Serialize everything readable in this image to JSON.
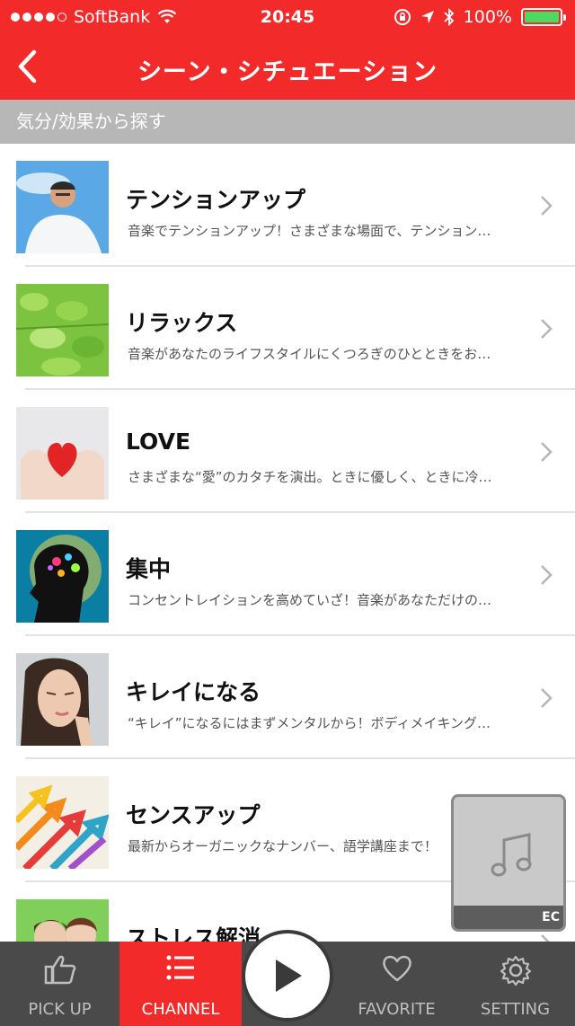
{
  "status": {
    "carrier": "SoftBank",
    "time": "20:45",
    "battery": "100%",
    "signal_bars": 5,
    "signal_filled": 4
  },
  "nav": {
    "title": "シーン・シチュエーション",
    "back_icon": "chevron-left-icon"
  },
  "section": {
    "header": "気分/効果から探す"
  },
  "items": [
    {
      "title": "テンションアップ",
      "desc": "音楽でテンションアップ！さまざまな場面で、テンション…",
      "thumb": "man-sky"
    },
    {
      "title": "リラックス",
      "desc": "音楽があなたのライフスタイルにくつろぎのひとときをお…",
      "thumb": "green-leaves"
    },
    {
      "title": "LOVE",
      "desc": "さまざまな“愛”のカタチを演出。ときに優しく、ときに冷…",
      "thumb": "heart-hands"
    },
    {
      "title": "集中",
      "desc": "コンセントレイションを高めていざ！音楽があなただけの…",
      "thumb": "brain"
    },
    {
      "title": "キレイになる",
      "desc": "“キレイ”になるにはまずメンタルから！ボディメイキング…",
      "thumb": "woman-face"
    },
    {
      "title": "センスアップ",
      "desc": "最新からオーガニックなナンバー、語学講座まで！",
      "thumb": "arrows"
    },
    {
      "title": "ストレス解消",
      "desc": "",
      "thumb": "people"
    }
  ],
  "mini_player": {
    "label": "EC"
  },
  "tabs": [
    {
      "label": "PICK UP",
      "icon": "thumbs-up-icon"
    },
    {
      "label": "CHANNEL",
      "icon": "list-icon"
    },
    {
      "label": "FAVORITE",
      "icon": "heart-icon"
    },
    {
      "label": "SETTING",
      "icon": "gear-icon"
    }
  ],
  "colors": {
    "brand_red": "#f22a2a",
    "tab_bg": "#4a4a4a",
    "section_bg": "#b7b7b7",
    "battery_green": "#4cd964"
  }
}
